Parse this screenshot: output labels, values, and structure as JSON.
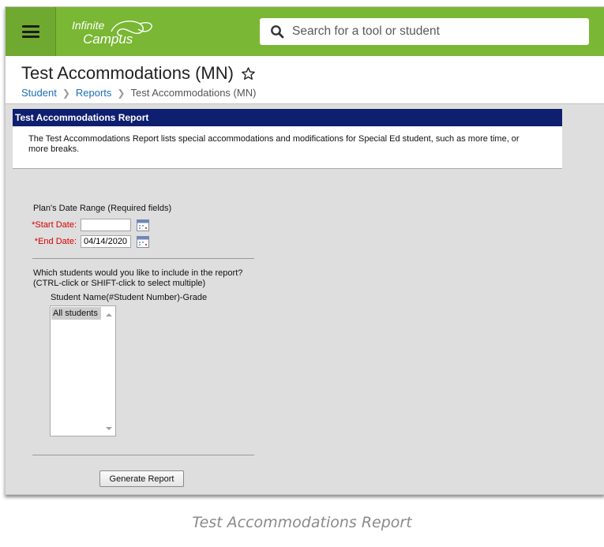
{
  "app": {
    "logo_line1": "Infinite",
    "logo_line2": "Campus",
    "brand_color": "#79b734"
  },
  "search": {
    "placeholder": "Search for a tool or student"
  },
  "page": {
    "title": "Test Accommodations (MN)",
    "breadcrumb": [
      "Student",
      "Reports",
      "Test Accommodations (MN)"
    ]
  },
  "report": {
    "header": "Test Accommodations Report",
    "description": "The Test Accommodations Report lists special accommodations and modifications for Special Ed student, such as more time, or more breaks.",
    "header_color": "#0f1f6f"
  },
  "form": {
    "date_range_label": "Plan's Date Range (Required fields)",
    "start_date_label": "*Start Date:",
    "start_date_value": "",
    "end_date_label": "*End Date:",
    "end_date_value": "04/14/2020",
    "students_question_line1": "Which students would you like to include in the report?",
    "students_question_line2": "(CTRL-click or SHIFT-click to select multiple)",
    "student_list_label": "Student Name(#Student Number)-Grade",
    "student_options": [
      "All students"
    ],
    "generate_button": "Generate Report"
  },
  "caption": "Test Accommodations Report"
}
